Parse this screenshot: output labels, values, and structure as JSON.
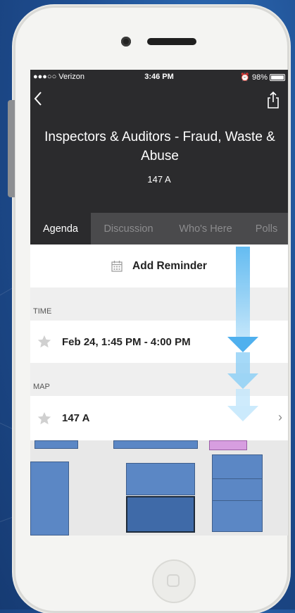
{
  "status_bar": {
    "carrier": "●●●○○ Verizon",
    "time": "3:46 PM",
    "battery": "98%"
  },
  "session": {
    "title": "Inspectors & Auditors - Fraud, Waste & Abuse",
    "room": "147 A"
  },
  "tabs": [
    {
      "label": "Agenda",
      "active": true
    },
    {
      "label": "Discussion",
      "active": false
    },
    {
      "label": "Who's Here",
      "active": false
    },
    {
      "label": "Polls",
      "active": false
    }
  ],
  "reminder": {
    "label": "Add Reminder",
    "icon": "calendar-icon"
  },
  "sections": {
    "time_header": "TIME",
    "time_value": "Feb 24, 1:45 PM - 4:00 PM",
    "map_header": "MAP",
    "map_value": "147 A"
  },
  "colors": {
    "header_bg": "#2b2b2d",
    "tab_bar_bg": "#4a4a4c",
    "map_room": "#5b87c5",
    "arrow": "#7fc8f2"
  },
  "icons": [
    "back-chevron-icon",
    "share-icon",
    "calendar-icon",
    "star-icon",
    "chevron-right-icon",
    "scroll-down-arrow-icon"
  ]
}
